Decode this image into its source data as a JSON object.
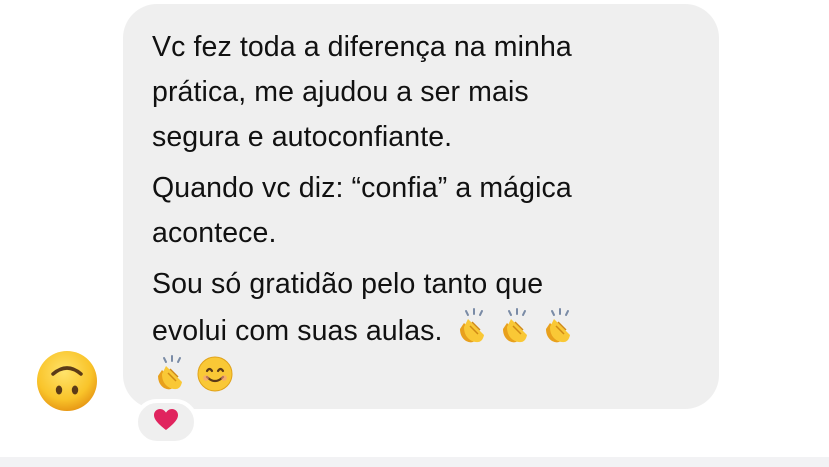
{
  "message": {
    "paragraphs": [
      {
        "lines": [
          "Vc fez toda a diferença na minha",
          "prática, me ajudou a ser mais",
          "segura e autoconfiante."
        ]
      },
      {
        "lines": [
          "Quando vc diz: “confia” a mágica",
          "acontece."
        ]
      },
      {
        "lines": [
          "Sou só gratidão pelo tanto que",
          "evolui com suas aulas."
        ]
      }
    ],
    "emojis_inline": [
      "clapping-hands-icon",
      "clapping-hands-icon",
      "clapping-hands-icon"
    ],
    "emojis_last_line": [
      "clapping-hands-icon",
      "smiling-face-icon"
    ]
  },
  "sender_avatar": {
    "icon": "upside-down-face-icon"
  },
  "reaction": {
    "icon": "red-heart-icon",
    "color": "#e0245e"
  },
  "colors": {
    "bubble": "#efefef",
    "text": "#111111",
    "emoji_yellow": "#f7c236"
  }
}
